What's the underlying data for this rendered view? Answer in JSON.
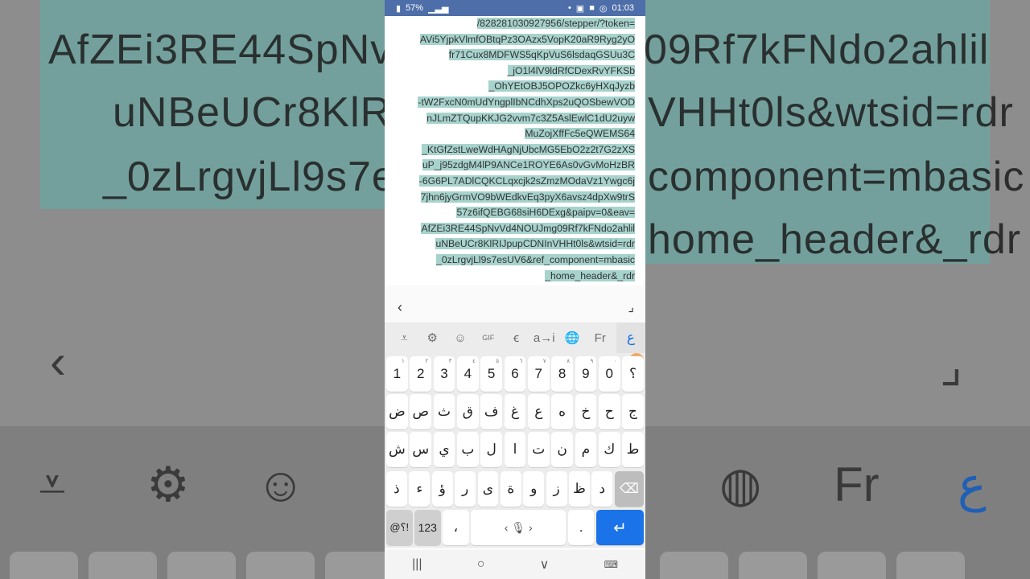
{
  "status": {
    "battery": "57%",
    "time": "01:03"
  },
  "selected_url_lines": [
    "/828281030927956/stepper/?token=",
    "AVi5YjpkVlmfOBtqPz3OAzx5VopK20aR9Ryg2yO",
    "fr71Cux8MDFWS5qKpVuS6lsdaqGSUu3C",
    "_jO1l4lV9ldRfCDexRvYFKSb",
    "_OhYEtOBJ5OPOZkc6yHXqJyzb",
    "-tW2FxcN0mUdYngplIbNCdhXps2uQOSbewVOD",
    "nJLmZTQupKKJG2vvm7c3Z5AslEwlC1dU2uyw",
    "MuZojXffFc5eQWEMS64",
    "_KtGfZstLweWdHAgNjUbcMG5EbO2z2t7G2zXS",
    "uP_j95zdgM4lP9ANCe1ROYE6As0vGvMoHzBR",
    "-6G6PL7ADlCQKCLqxcjk2sZmzMOdaVz1Ywgc6j",
    "7jhn6jyGrmVO9bWEdkvEq3pyX6avsz4dpXw9trS",
    "57z6ifQEBG68siH6DExg&paipv=0&eav=",
    "AfZEi3RE44SpNvVd4NOUJmg09Rf7kFNdo2ahlil",
    "uNBeUCr8KlRIJpupCDNInVHHt0ls&wtsid=rdr",
    "_0zLrgvjLl9s7esUV6&ref_component=mbasic",
    "_home_header&_rdr"
  ],
  "background_text": [
    "AfZEi3RE44SpNv",
    "09Rf7kFNdo2ahlil",
    "uNBeUCr8KlRl",
    "VHHt0ls&wtsid=rdr",
    "_0zLrgvjLl9s7e",
    "component=mbasic",
    "home_header&_rdr"
  ],
  "keyboard": {
    "toolbar": [
      "⩡",
      "⚙",
      "☺",
      "GIF",
      "ꞓ",
      "a→i",
      "🌐",
      "Fr",
      "ع"
    ],
    "row_numbers": [
      {
        "k": "1",
        "s": "١"
      },
      {
        "k": "2",
        "s": "٢"
      },
      {
        "k": "3",
        "s": "٣"
      },
      {
        "k": "4",
        "s": "٤"
      },
      {
        "k": "5",
        "s": "٥"
      },
      {
        "k": "6",
        "s": "٦"
      },
      {
        "k": "7",
        "s": "٧"
      },
      {
        "k": "8",
        "s": "٨"
      },
      {
        "k": "9",
        "s": "٩"
      },
      {
        "k": "0",
        "s": "٠"
      },
      {
        "k": "؟",
        "s": ""
      }
    ],
    "row1": [
      "ض",
      "ص",
      "ث",
      "ق",
      "ف",
      "غ",
      "ع",
      "ه",
      "خ",
      "ح",
      "ج"
    ],
    "row2": [
      "ش",
      "س",
      "ي",
      "ب",
      "ل",
      "ا",
      "ت",
      "ن",
      "م",
      "ك",
      "ط"
    ],
    "row3": [
      "ذ",
      "ء",
      "ؤ",
      "ر",
      "ى",
      "ة",
      "و",
      "ز",
      "ظ",
      "د"
    ],
    "bottom": {
      "sym": "@؟!",
      "num": "123",
      "comma": "،",
      "period": ".",
      "enter": "↵"
    }
  },
  "nav": [
    "|||",
    "○",
    "∨",
    "⌨"
  ]
}
